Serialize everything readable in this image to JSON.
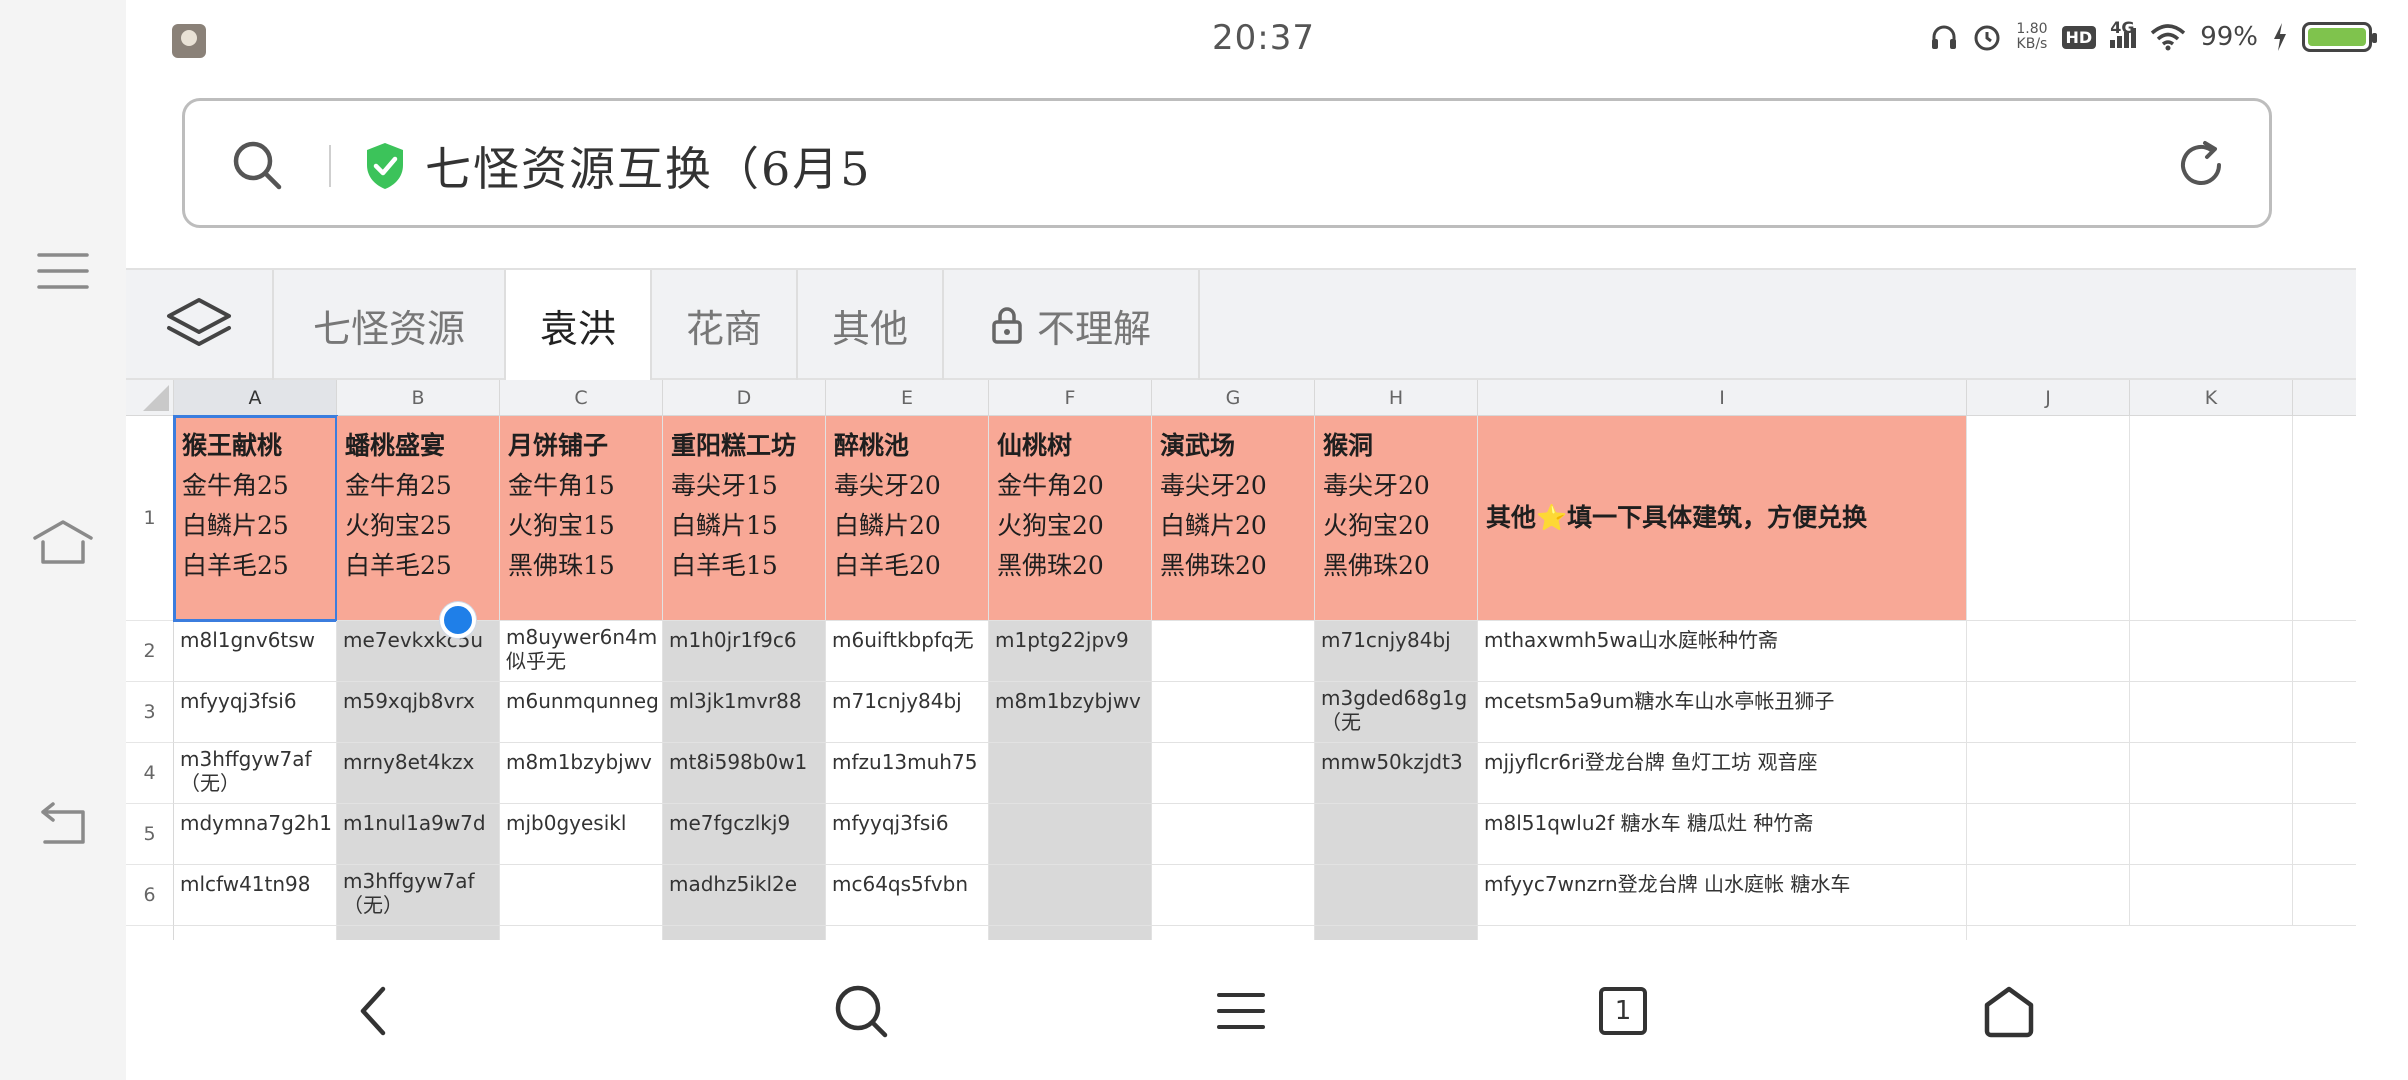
{
  "status_bar": {
    "time": "20:37",
    "net_speed_top": "1.80",
    "net_speed_unit": "KB/s",
    "hd_label": "HD",
    "network_label": "4G",
    "battery": "99%",
    "icons": [
      "headphones-icon",
      "alarm-icon",
      "hd-icon",
      "signal-icon",
      "wifi-icon",
      "charging-icon",
      "battery-icon"
    ]
  },
  "address_bar": {
    "title": "七怪资源互换（6月5",
    "secure": true
  },
  "sheet_tabs": [
    {
      "label": "七怪资源",
      "active": false,
      "locked": false
    },
    {
      "label": "袁洪",
      "active": true,
      "locked": false
    },
    {
      "label": "花商",
      "active": false,
      "locked": false
    },
    {
      "label": "其他",
      "active": false,
      "locked": false
    },
    {
      "label": "不理解",
      "active": false,
      "locked": true
    }
  ],
  "columns": [
    "A",
    "B",
    "C",
    "D",
    "E",
    "F",
    "G",
    "H",
    "I",
    "J",
    "K"
  ],
  "row_numbers": [
    "1",
    "2",
    "3",
    "4",
    "5",
    "6"
  ],
  "header_row": [
    {
      "title": "猴王献桃",
      "lines": [
        "金牛角25",
        "白鳞片25",
        "白羊毛25"
      ]
    },
    {
      "title": "蟠桃盛宴",
      "lines": [
        "金牛角25",
        "火狗宝25",
        "白羊毛25"
      ]
    },
    {
      "title": "月饼铺子",
      "lines": [
        "金牛角15",
        "火狗宝15",
        "黑佛珠15"
      ]
    },
    {
      "title": "重阳糕工坊",
      "lines": [
        "毒尖牙15",
        "白鳞片15",
        "白羊毛15"
      ]
    },
    {
      "title": "醉桃池",
      "lines": [
        "毒尖牙20",
        "白鳞片20",
        "白羊毛20"
      ]
    },
    {
      "title": "仙桃树",
      "lines": [
        "金牛角20",
        "火狗宝20",
        "黑佛珠20"
      ]
    },
    {
      "title": "演武场",
      "lines": [
        "毒尖牙20",
        "白鳞片20",
        "黑佛珠20"
      ]
    },
    {
      "title": "猴洞",
      "lines": [
        "毒尖牙20",
        "火狗宝20",
        "黑佛珠20"
      ]
    }
  ],
  "header_wide": "其他⭐填一下具体建筑，方便兑换",
  "rows": [
    [
      "m8l1gnv6tsw",
      "me7evkxkc5u",
      "m8uywer6n4m 似乎无",
      "m1h0jr1f9c6",
      "m6uiftkbpfq无",
      "m1ptg22jpv9",
      "",
      "m71cnjy84bj",
      "mthaxwmh5wa山水庭帐种竹斋"
    ],
    [
      "mfyyqj3fsi6",
      "m59xqjb8vrx",
      "m6unmqunneg",
      "ml3jk1mvr88",
      "m71cnjy84bj",
      "m8m1bzybjwv",
      "",
      "m3gded68g1g（无",
      "mcetsm5a9um糖水车山水亭帐丑狮子"
    ],
    [
      "m3hffgyw7af （无）",
      "mrny8et4kzx",
      "m8m1bzybjwv",
      "mt8i598b0w1",
      "mfzu13muh75",
      "",
      "",
      "mmw50kzjdt3",
      "mjjyflcr6ri登龙台牌 鱼灯工坊 观音座"
    ],
    [
      "mdymna7g2h1",
      "m1nul1a9w7d",
      "mjb0gyesikl",
      "me7fgczlkj9",
      "mfyyqj3fsi6",
      "",
      "",
      "",
      "m8l51qwlu2f  糖水车 糖瓜灶 种竹斋"
    ],
    [
      "mlcfw41tn98",
      "m3hffgyw7af（无）",
      "",
      "madhz5ikl2e",
      "mc64qs5fvbn",
      "",
      "",
      "",
      "mfyyc7wnzrn登龙台牌 山水庭帐 糖水车"
    ]
  ],
  "gray_cols": [
    1,
    3,
    5,
    7
  ],
  "bottom_nav": [
    "back-icon",
    "search-icon",
    "menu-icon",
    "tabs-icon",
    "home-icon"
  ],
  "tab_count": "1",
  "colors": {
    "header_fill": "#f8a896",
    "gray_fill": "#d9d9d9",
    "accent_blue": "#1f7fe8",
    "shield_green": "#3cc35a"
  }
}
